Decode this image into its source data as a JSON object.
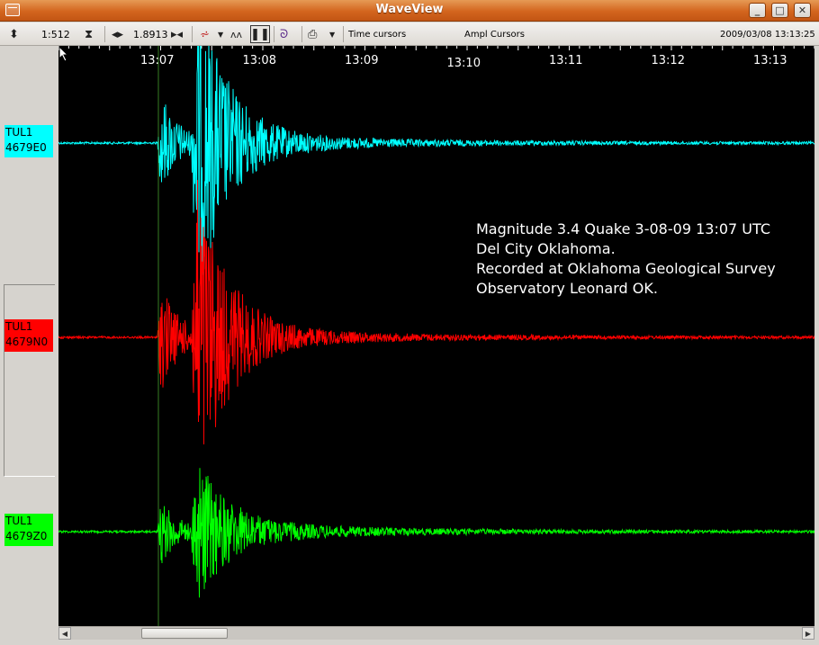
{
  "window": {
    "title": "WaveView"
  },
  "toolbar": {
    "vertical_scale": "1:512",
    "horizontal_scale": "1.8913",
    "time_cursors_label": "Time cursors",
    "ampl_cursors_label": "Ampl Cursors",
    "datetime": "2009/03/08 13:13:25"
  },
  "time_axis": {
    "ticks": [
      "13:07",
      "13:08",
      "13:09",
      "13:10",
      "13:11",
      "13:12",
      "13:13"
    ]
  },
  "channels": [
    {
      "station": "TUL1",
      "channel": "4679E0",
      "color": "#00ffff",
      "label_bg": "#00ffff"
    },
    {
      "station": "TUL1",
      "channel": "4679N0",
      "color": "#ff0000",
      "label_bg": "#ff0000"
    },
    {
      "station": "TUL1",
      "channel": "4679Z0",
      "color": "#00ff00",
      "label_bg": "#00ff00"
    }
  ],
  "annotation": {
    "line1": "Magnitude 3.4 Quake 3-08-09 13:07 UTC",
    "line2": "Del City Oklahoma.",
    "line3": "Recorded at Oklahoma Geological Survey",
    "line4": "Observatory Leonard OK."
  },
  "icons": {
    "vertical-zoom": "up-down-arrows-icon",
    "vertical-fit": "hourglass-arrows-icon",
    "horizontal-zoom": "left-right-arrows-icon",
    "horizontal-fit": "bowtie-arrows-icon",
    "filter": "filter-icon",
    "waveform": "waveform-icon",
    "pause": "pause-icon",
    "spectrum": "spectrum-icon",
    "print": "printer-icon"
  }
}
